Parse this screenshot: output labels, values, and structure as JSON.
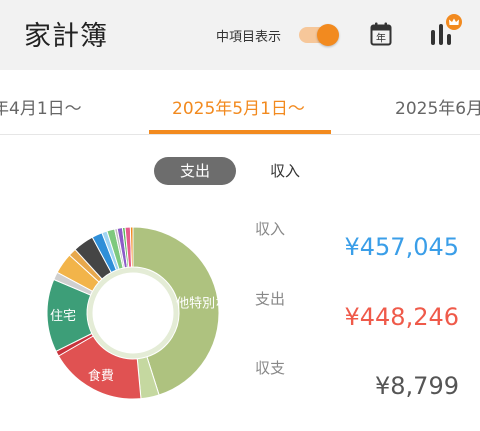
{
  "header": {
    "title": "家計簿",
    "toggle_label": "中項目表示",
    "toggle_on": true,
    "calendar_icon_text": "年",
    "icons": [
      "calendar-icon",
      "bar-chart-icon",
      "crown-icon"
    ]
  },
  "periods": {
    "prev": "年4月1日～",
    "current": "2025年5月1日～",
    "next": "2025年6月"
  },
  "segment": {
    "expense": "支出",
    "income": "収入",
    "selected": "支出"
  },
  "chart_data": {
    "type": "pie",
    "style": "donut",
    "slices": [
      {
        "label": "他特別な",
        "value": 46,
        "color": "#aec27f"
      },
      {
        "label": "",
        "value": 3.5,
        "color": "#c5d8a0"
      },
      {
        "label": "食費",
        "value": 18.5,
        "color": "#e05252"
      },
      {
        "label": "",
        "value": 1,
        "color": "#c8323c"
      },
      {
        "label": "住宅",
        "value": 14,
        "color": "#3d9e78"
      },
      {
        "label": "",
        "value": 1.5,
        "color": "#cfcfcf"
      },
      {
        "label": "",
        "value": 4,
        "color": "#f2b44a"
      },
      {
        "label": "",
        "value": 1.5,
        "color": "#e8a84c"
      },
      {
        "label": "",
        "value": 4,
        "color": "#454545"
      },
      {
        "label": "",
        "value": 2,
        "color": "#2f8fd8"
      },
      {
        "label": "",
        "value": 1,
        "color": "#9fd4f2"
      },
      {
        "label": "",
        "value": 1.5,
        "color": "#7ec97e"
      },
      {
        "label": "",
        "value": 0.5,
        "color": "#c0c0c0"
      },
      {
        "label": "",
        "value": 1,
        "color": "#8b5bc8"
      },
      {
        "label": "",
        "value": 0.5,
        "color": "#5cb85c"
      },
      {
        "label": "",
        "value": 1,
        "color": "#e65a8c"
      },
      {
        "label": "",
        "value": 0.5,
        "color": "#f28a1f"
      }
    ]
  },
  "summary": {
    "income_label": "収入",
    "income_value": "¥457,045",
    "income_color": "#3a9ee8",
    "expense_label": "支出",
    "expense_value": "¥448,246",
    "expense_color": "#ef5a4a",
    "balance_label": "収支",
    "balance_value": "¥8,799",
    "balance_color": "#555555"
  }
}
